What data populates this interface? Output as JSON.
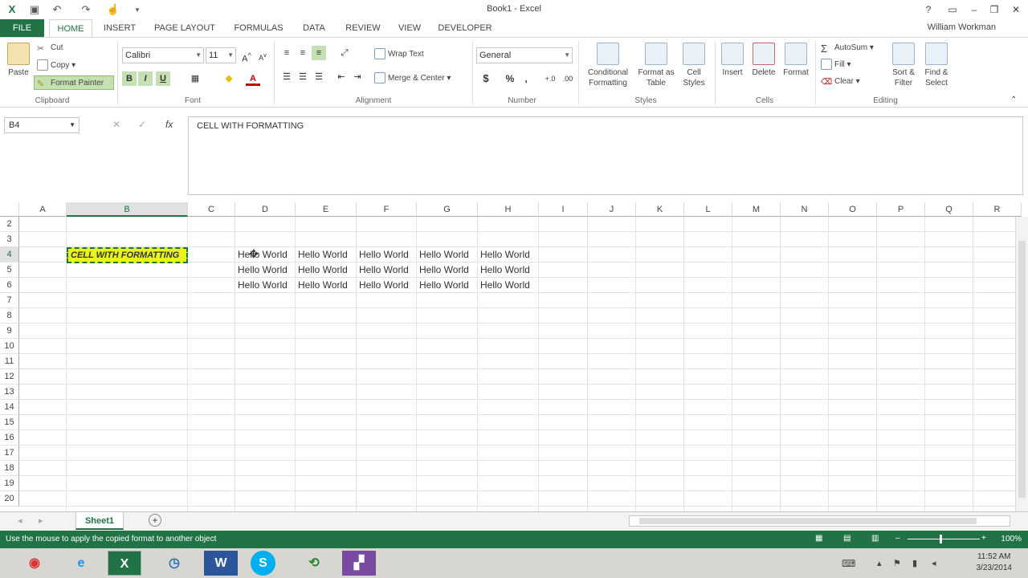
{
  "window": {
    "title": "Book1 - Excel",
    "user": "William Workman"
  },
  "tabs": {
    "file": "FILE",
    "items": [
      "HOME",
      "INSERT",
      "PAGE LAYOUT",
      "FORMULAS",
      "DATA",
      "REVIEW",
      "VIEW",
      "DEVELOPER"
    ]
  },
  "ribbon": {
    "clipboard": {
      "paste": "Paste",
      "cut": "Cut",
      "copy": "Copy",
      "format_painter": "Format Painter",
      "label": "Clipboard"
    },
    "font": {
      "name": "Calibri",
      "size": "11",
      "bold": "B",
      "italic": "I",
      "underline": "U",
      "label": "Font"
    },
    "alignment": {
      "wrap": "Wrap Text",
      "merge": "Merge & Center",
      "label": "Alignment"
    },
    "number": {
      "format": "General",
      "currency": "$",
      "percent": "%",
      "comma": ",",
      "label": "Number"
    },
    "styles": {
      "conditional_1": "Conditional",
      "conditional_2": "Formatting",
      "format_table_1": "Format as",
      "format_table_2": "Table",
      "cell_styles_1": "Cell",
      "cell_styles_2": "Styles",
      "label": "Styles"
    },
    "cells": {
      "insert": "Insert",
      "delete": "Delete",
      "format": "Format",
      "label": "Cells"
    },
    "editing": {
      "autosum": "AutoSum",
      "fill": "Fill",
      "clear": "Clear",
      "sort_1": "Sort &",
      "sort_2": "Filter",
      "find_1": "Find &",
      "find_2": "Select",
      "label": "Editing"
    }
  },
  "formula_bar": {
    "name_box": "B4",
    "fx": "fx",
    "content": "CELL WITH FORMATTING"
  },
  "grid": {
    "columns": [
      "A",
      "B",
      "C",
      "D",
      "E",
      "F",
      "G",
      "H",
      "I",
      "J",
      "K",
      "L",
      "M",
      "N",
      "O",
      "P",
      "Q",
      "R"
    ],
    "rows": [
      "2",
      "3",
      "4",
      "5",
      "6",
      "7",
      "8",
      "9",
      "10",
      "11",
      "12",
      "13",
      "14",
      "15",
      "16",
      "17",
      "18",
      "19",
      "20"
    ],
    "b4_value": "CELL WITH FORMATTING",
    "hello": "Hello World"
  },
  "sheets": {
    "active": "Sheet1"
  },
  "status": {
    "message": "Use the mouse to apply the copied format to another object",
    "zoom": "100%"
  },
  "taskbar": {
    "time": "11:52 AM",
    "date": "3/23/2014"
  },
  "colors": {
    "excel_green": "#217346",
    "highlight_yellow": "#e8f518"
  }
}
